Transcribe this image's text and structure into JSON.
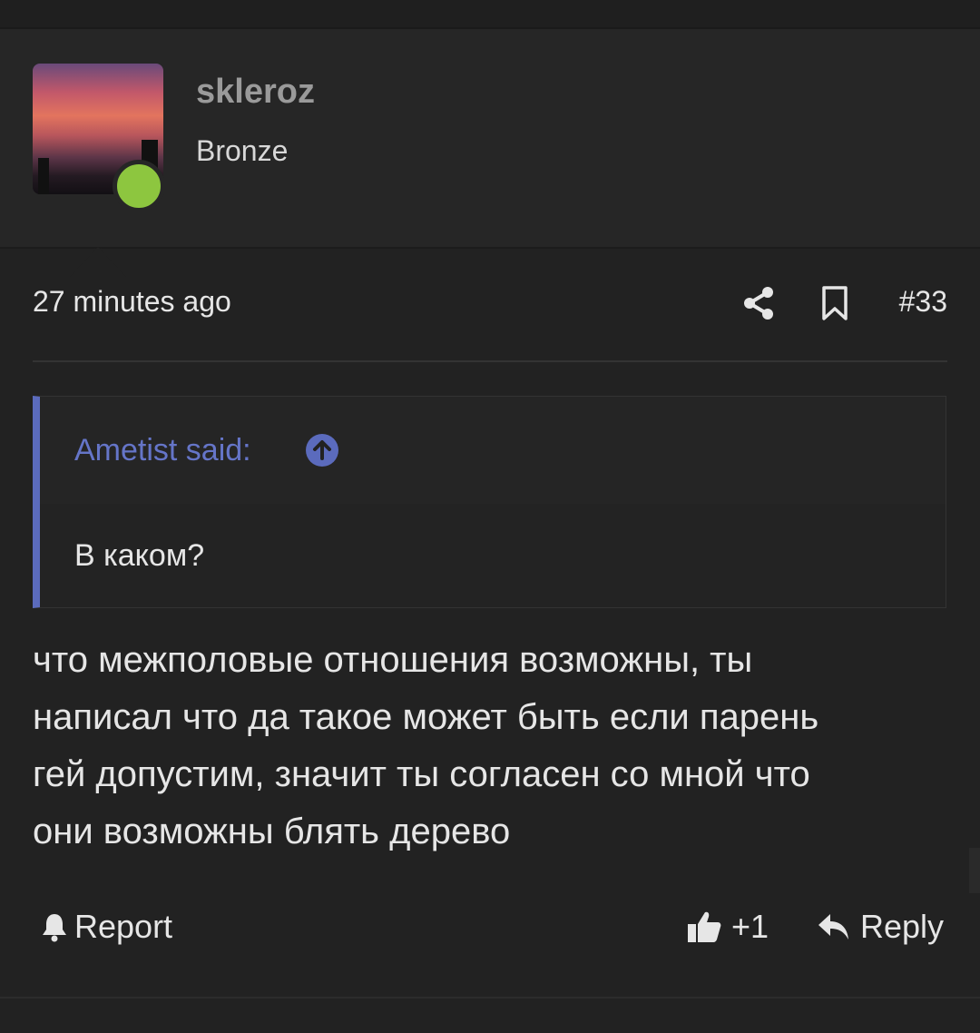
{
  "user": {
    "name": "skleroz",
    "rank": "Bronze",
    "online_color": "#8dc63f"
  },
  "meta": {
    "time": "27 minutes ago",
    "post_number": "#33",
    "icons": [
      "share-icon",
      "bookmark-icon"
    ]
  },
  "quote": {
    "author_label": "Ametist said:",
    "text": "В каком?",
    "accent_color": "#5b6bbd"
  },
  "post": {
    "lines": [
      "что межполовые отношения возможны, ты",
      "написал что да такое может быть если парень",
      "гей допустим, значит ты согласен со мной что",
      "они возможны блять дерево"
    ]
  },
  "actions": {
    "report_label": "Report",
    "like_count": "+1",
    "reply_label": "Reply"
  }
}
